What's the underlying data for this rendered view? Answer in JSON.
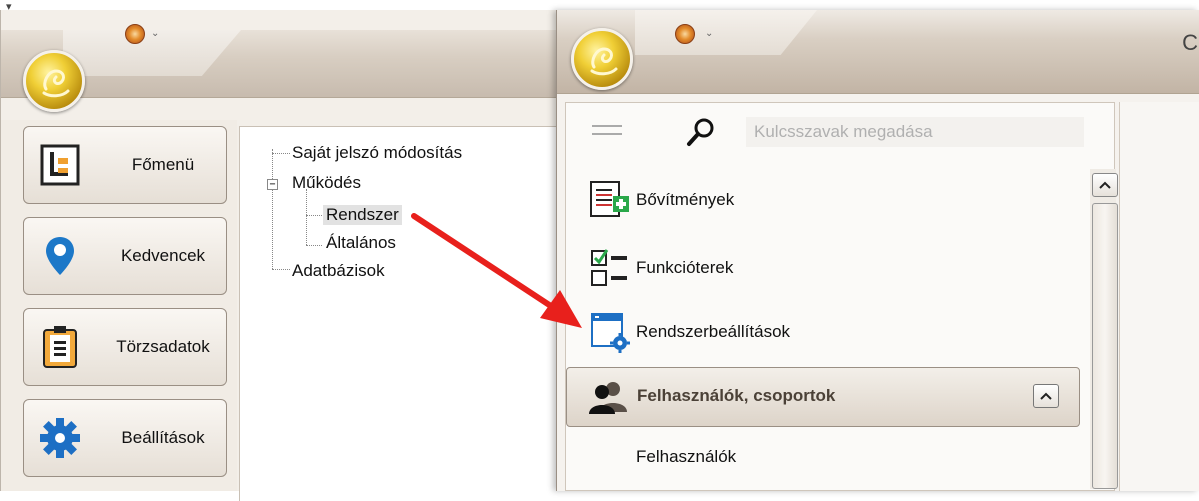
{
  "left_window": {
    "nav": [
      {
        "label": "Főmenü",
        "icon": "main-menu-icon"
      },
      {
        "label": "Kedvencek",
        "icon": "map-pin-icon"
      },
      {
        "label": "Törzsadatok",
        "icon": "clipboard-icon"
      },
      {
        "label": "Beállítások",
        "icon": "gear-icon"
      }
    ],
    "tree": {
      "item1": "Saját jelszó módosítás",
      "item2": "Működés",
      "item2_children": [
        "Rendszer",
        "Általános"
      ],
      "item3": "Adatbázisok",
      "selected": "Rendszer"
    }
  },
  "right_window": {
    "search": {
      "placeholder": "Kulcsszavak megadása"
    },
    "menu": [
      {
        "label": "Bővítmények",
        "icon": "extensions-icon"
      },
      {
        "label": "Funkcióterek",
        "icon": "checklist-icon"
      },
      {
        "label": "Rendszerbeállítások",
        "icon": "window-settings-icon"
      }
    ],
    "group": {
      "label": "Felhasználók, csoportok",
      "icon": "users-icon"
    },
    "group_items": [
      "Felhasználók"
    ]
  },
  "colors": {
    "accent_arrow": "#e8201c",
    "orb_gold": "#f0cf36",
    "window_chrome": "#d8cec2"
  }
}
